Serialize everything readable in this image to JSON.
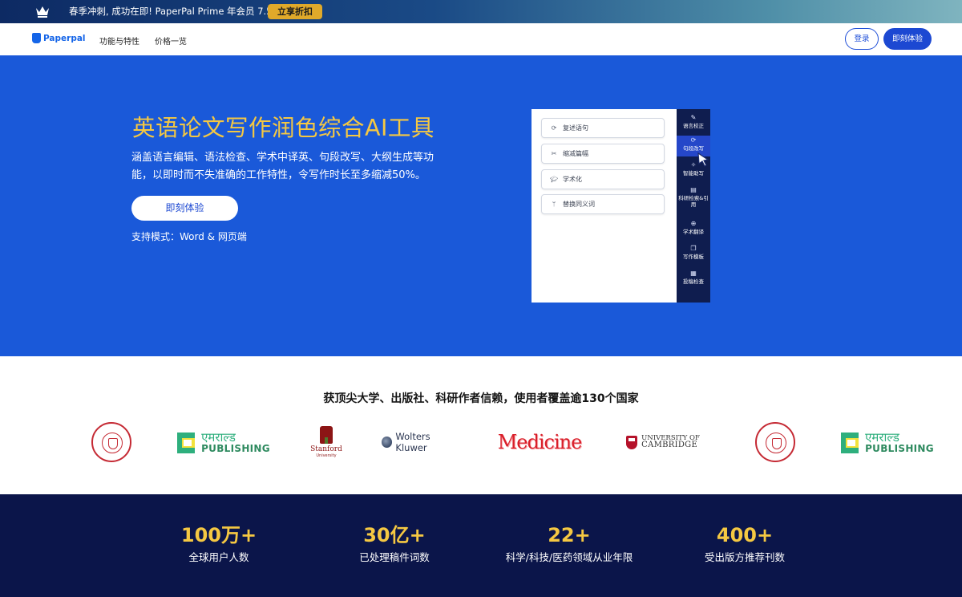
{
  "promo": {
    "text": "春季冲刺, 成功在即! PaperPal Prime 年会员 7.5折",
    "button": "立享折扣",
    "icon": "crown-icon"
  },
  "nav": {
    "logo_text": "Paperpal",
    "links": [
      "功能与特性",
      "价格一览"
    ],
    "login": "登录",
    "try": "即刻体验"
  },
  "hero": {
    "title": "英语论文写作润色综合AI工具",
    "description": "涵盖语言编辑、语法检查、学术中译英、句段改写、大纲生成等功能，以即时而不失准确的工作特性，令写作时长至多缩减50%。",
    "cta": "即刻体验",
    "support": "支持模式：Word & 网页端",
    "colors": {
      "background": "#1a59d9",
      "title": "#f5c842"
    }
  },
  "mock": {
    "options": [
      {
        "label": "复述语句",
        "icon": "refresh-icon"
      },
      {
        "label": "缩减篇幅",
        "icon": "scissors-icon"
      },
      {
        "label": "学术化",
        "icon": "graduation-cap-icon"
      },
      {
        "label": "替换同义词",
        "icon": "branch-icon"
      }
    ],
    "sidebar": [
      {
        "label": "语言校正",
        "icon": "feather-icon"
      },
      {
        "label": "句段改写",
        "icon": "refresh-icon",
        "active": true
      },
      {
        "label": "智能助写",
        "icon": "sparkle-icon"
      },
      {
        "label": "科研检索&引用",
        "icon": "book-icon"
      },
      {
        "label": "学术翻译",
        "icon": "globe-icon"
      },
      {
        "label": "写作模板",
        "icon": "copy-icon"
      },
      {
        "label": "投稿检查",
        "icon": "checklist-icon"
      }
    ]
  },
  "trust": {
    "title": "获顶尖大学、出版社、科研作者信赖，使用者覆盖逾130个国家",
    "logos": [
      {
        "name": "cornell-seal",
        "text": "CORNELL UNIVERSITY · FOUNDED A.D. 1865"
      },
      {
        "name": "emerald-publishing",
        "hindi": "एमराल्ड",
        "text": "PUBLISHING"
      },
      {
        "name": "stanford",
        "text": "Stanford",
        "sub": "University"
      },
      {
        "name": "wolters-kluwer",
        "text": "Wolters Kluwer"
      },
      {
        "name": "medicine",
        "text": "Medicine"
      },
      {
        "name": "cambridge",
        "t1": "UNIVERSITY OF",
        "t2": "CAMBRIDGE"
      },
      {
        "name": "cornell-seal",
        "text": "CORNELL UNIVERSITY · FOUNDED A.D. 1865"
      },
      {
        "name": "emerald-publishing",
        "hindi": "एमराल्ड",
        "text": "PUBLISHING"
      }
    ]
  },
  "stats": [
    {
      "value": "100万+",
      "label": "全球用户人数"
    },
    {
      "value": "30亿+",
      "label": "已处理稿件词数"
    },
    {
      "value": "22+",
      "label": "科学/科技/医药领域从业年限"
    },
    {
      "value": "400+",
      "label": "受出版方推荐刊数"
    }
  ]
}
